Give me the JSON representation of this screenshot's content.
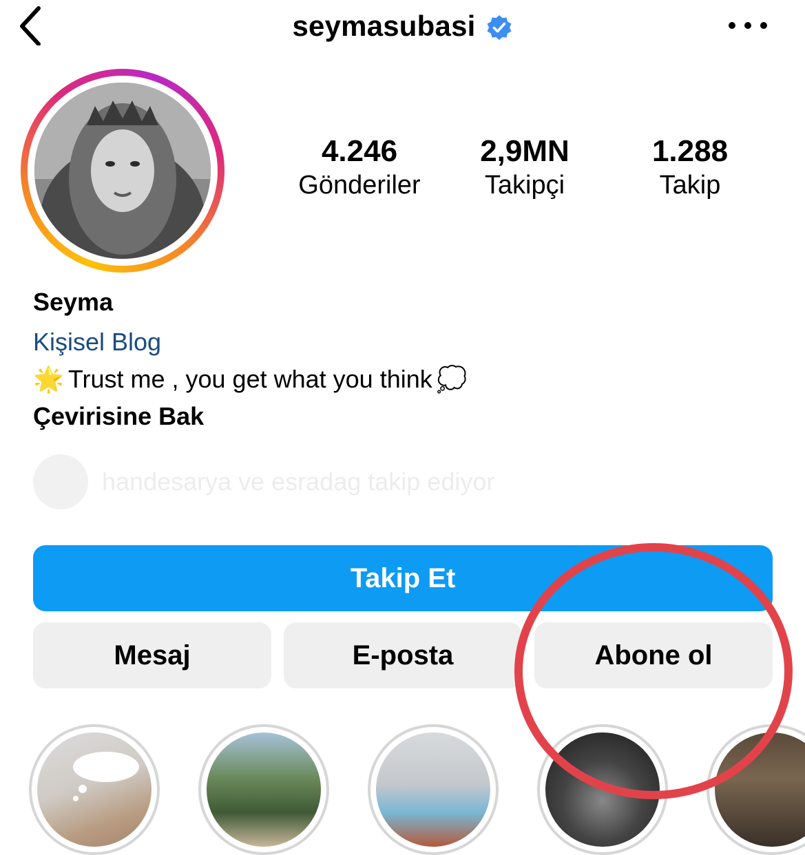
{
  "header": {
    "username": "seymasubasi",
    "back_icon": "chevron-left-icon",
    "verified_icon": "verified-badge-icon",
    "more_icon": "more-horizontal-icon"
  },
  "profile": {
    "stats": [
      {
        "value": "4.246",
        "label": "Gönderiler"
      },
      {
        "value": "2,9MN",
        "label": "Takipçi"
      },
      {
        "value": "1.288",
        "label": "Takip"
      }
    ],
    "name": "Seyma",
    "category": "Kişisel Blog",
    "bio_emoji": "🌟",
    "bio_text": "Trust me , you get what you think",
    "bio_emoji_end": "💭",
    "translate_label": "Çevirisine Bak",
    "followed_by": "handesarya ve esradag takip ediyor"
  },
  "actions": {
    "follow": "Takip Et",
    "message": "Mesaj",
    "email": "E-posta",
    "subscribe": "Abone ol"
  },
  "colors": {
    "follow_button": "#0d9bf3",
    "secondary_button": "#efefef",
    "category_link": "#1a4c7e",
    "verified_badge": "#3d8ef0",
    "annotation_circle": "#e2434b"
  }
}
